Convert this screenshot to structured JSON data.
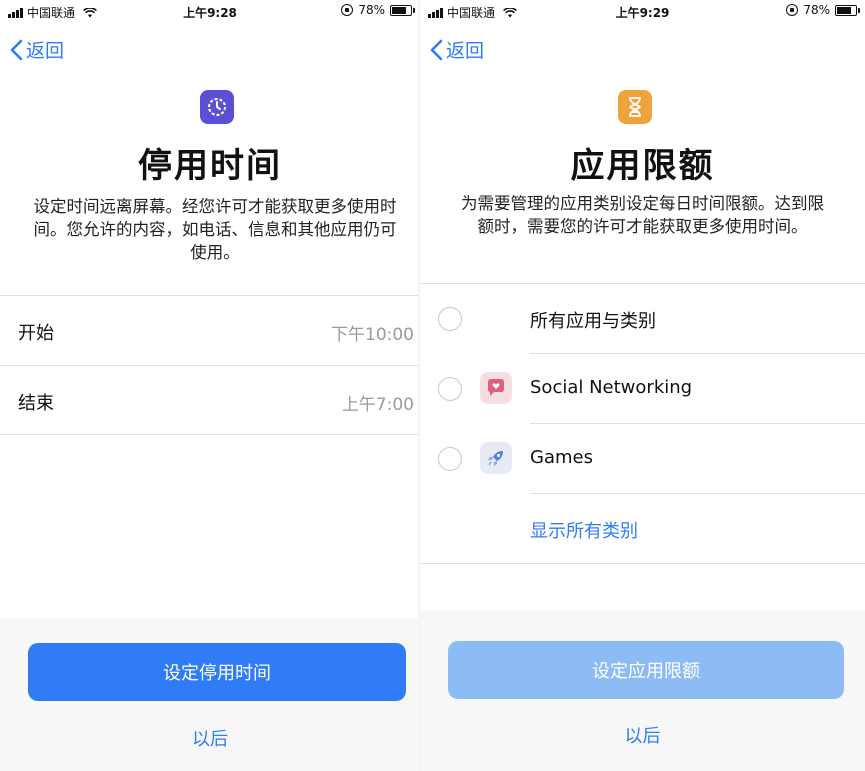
{
  "left": {
    "status": {
      "carrier": "中国联通",
      "time": "上午9:28",
      "battery": "78%"
    },
    "nav": {
      "back_label": "返回"
    },
    "title": "停用时间",
    "description": "设定时间远离屏幕。经您许可才能获取更多使用时间。您允许的内容，如电话、信息和其他应用仍可使用。",
    "rows": [
      {
        "label": "开始",
        "value": "下午10:00"
      },
      {
        "label": "结束",
        "value": "上午7:00"
      }
    ],
    "button": "设定停用时间",
    "later": "以后",
    "colors": {
      "accent": "#2f7cf6",
      "icon_bg": "#5b4fd6"
    }
  },
  "right": {
    "status": {
      "carrier": "中国联通",
      "time": "上午9:29",
      "battery": "78%"
    },
    "nav": {
      "back_label": "返回"
    },
    "title": "应用限额",
    "description": "为需要管理的应用类别设定每日时间限额。达到限额时，需要您的许可才能获取更多使用时间。",
    "options": [
      {
        "label": "所有应用与类别",
        "icon": "none"
      },
      {
        "label": "Social Networking",
        "icon": "chat-heart-icon"
      },
      {
        "label": "Games",
        "icon": "rocket-icon"
      }
    ],
    "show_all": "显示所有类别",
    "button": "设定应用限额",
    "later": "以后",
    "colors": {
      "accent": "#2f7cf6",
      "button_disabled": "#8cbcf3",
      "icon_bg": "#f0a33a"
    }
  }
}
